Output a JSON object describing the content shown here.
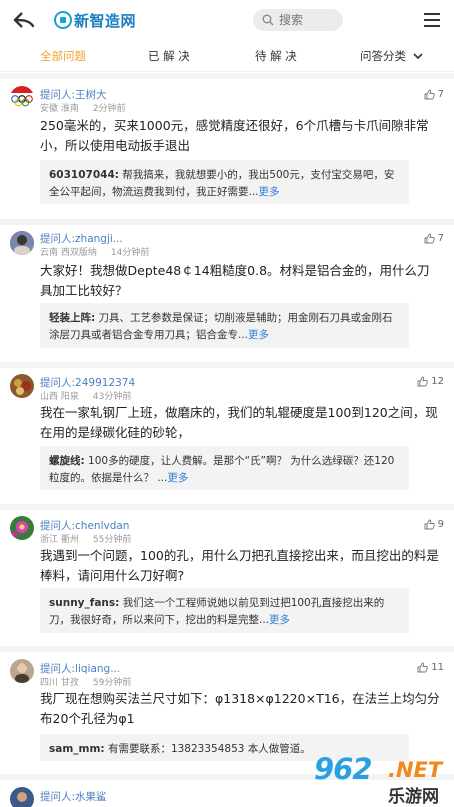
{
  "header": {
    "logo_text": "新智造网",
    "search_placeholder": "搜索"
  },
  "tabs": [
    "全部问题",
    "已 解 决",
    "待 解 决",
    "问答分类"
  ],
  "colors": {
    "accent": "#f0a32b",
    "link": "#2f7fd4",
    "asker": "#4a7fc0"
  },
  "questions": [
    {
      "asker": "提问人:王树大",
      "location": "安徽 淮南",
      "time": "2分钟前",
      "likes": "7",
      "avatar_icon": "olympic-rings-icon",
      "text": "250毫米的，买来1000元，感觉精度还很好，6个爪槽与卡爪间隙非常小，所以使用电动扳手退出",
      "answer_user": "603107044:",
      "answer_text": " 帮我搞来，我就想要小的，我出500元，支付宝交易吧，安全公平起间，物流运费我到付，我正好需要...",
      "more": "更多"
    },
    {
      "asker": "提问人:zhangji...",
      "location": "云南 西双版纳",
      "time": "14分钟前",
      "likes": "7",
      "avatar_icon": "user-photo-icon",
      "text": "大家好！我想做Depte48￠14粗糙度0.8。材料是铝合金的，用什么刀具加工比较好？",
      "answer_user": "轻装上阵:",
      "answer_text": " 刀具、工艺参数是保证；切削液是辅助；用金刚石刀具或金刚石涂层刀具或者铝合金专用刀具；铝合金专...",
      "more": "更多"
    },
    {
      "asker": "提问人:249912374",
      "location": "山西 阳泉",
      "time": "43分钟前",
      "likes": "12",
      "avatar_icon": "food-photo-icon",
      "text": "我在一家轧钢厂上班，做磨床的，我们的轧辊硬度是100到120之间，现在用的是绿碳化硅的砂轮，",
      "answer_user": "螺旋线:",
      "answer_text": " 100多的硬度，让人费解。是那个“氏”啊？ 为什么选绿碳？还120粒度的。依据是什么？ ...",
      "more": "更多"
    },
    {
      "asker": "提问人:chenlvdan",
      "location": "浙江 衢州",
      "time": "55分钟前",
      "likes": "9",
      "avatar_icon": "flower-photo-icon",
      "text": "我遇到一个问题，100的孔，用什么刀把孔直接挖出来，而且挖出的料是棒料，请问用什么刀好啊?",
      "answer_user": "sunny_fans:",
      "answer_text": " 我们这一个工程师说她以前见到过把100孔直接挖出来的刀，我很好奇，所以来问下，挖出的料是完整...",
      "more": "更多"
    },
    {
      "asker": "提问人:liqiang...",
      "location": "四川 甘孜",
      "time": "59分钟前",
      "likes": "11",
      "avatar_icon": "portrait-photo-icon",
      "text": "我厂现在想购买法兰尺寸如下：φ1318×φ1220×T16，在法兰上均匀分布20个孔径为φ1",
      "answer_user": "sam_mm:",
      "answer_text": " 有需要联系：13823354853 本人做管道。",
      "more": ""
    },
    {
      "asker": "提问人:水果鲨",
      "location": "",
      "time": "",
      "likes": "",
      "avatar_icon": "user-photo-icon",
      "text": "",
      "answer_user": "",
      "answer_text": "",
      "more": ""
    }
  ],
  "watermark": {
    "number": "962",
    "net": ".NET",
    "cn": "乐游网"
  }
}
